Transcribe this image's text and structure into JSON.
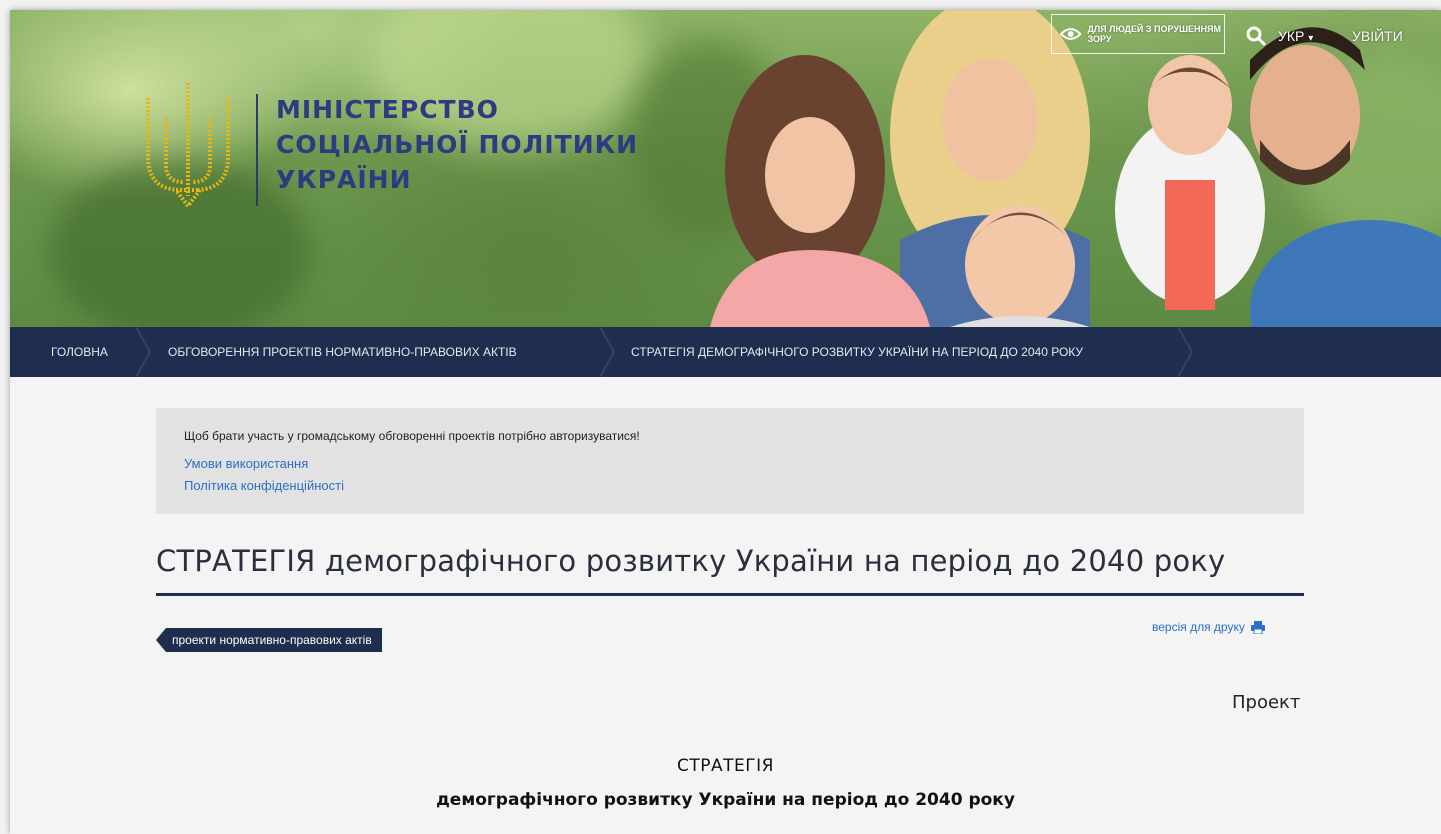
{
  "header": {
    "ministry_lines": [
      "МІНІСТЕРСТВО",
      "СОЦІАЛЬНОЇ ПОЛІТИКИ",
      "УКРАЇНИ"
    ],
    "vision_button": "ДЛЯ ЛЮДЕЙ З ПОРУШЕННЯМ ЗОРУ",
    "language": "УКР",
    "login": "УВІЙТИ"
  },
  "nav": {
    "items": [
      "ГОЛОВНА",
      "ОБГОВОРЕННЯ ПРОЕКТІВ НОРМАТИВНО-ПРАВОВИХ АКТІВ",
      "СТРАТЕГІЯ ДЕМОГРАФІЧНОГО РОЗВИТКУ УКРАЇНИ НА ПЕРІОД ДО 2040 РОКУ"
    ]
  },
  "notice": {
    "message": "Щоб брати участь у громадському обговоренні проектів потрібно авторизуватися!",
    "links": [
      "Умови використання",
      "Політика конфіденційності"
    ]
  },
  "page": {
    "title": "СТРАТЕГІЯ демографічного розвитку України на період до 2040 року",
    "tag": "проекти нормативно-правових актів",
    "print_link": "версія для друку"
  },
  "document": {
    "status": "Проект",
    "heading": "СТРАТЕГІЯ",
    "subheading": "демографічного розвитку України на період до 2040 року"
  },
  "colors": {
    "nav_bg": "#1f2d4e",
    "brand_text": "#2f3a82",
    "link": "#2c6fc7",
    "emblem_gold": "#e8b617"
  },
  "icons": [
    "trident-emblem-icon",
    "eye-icon",
    "search-icon",
    "caret-down-icon",
    "printer-icon"
  ]
}
